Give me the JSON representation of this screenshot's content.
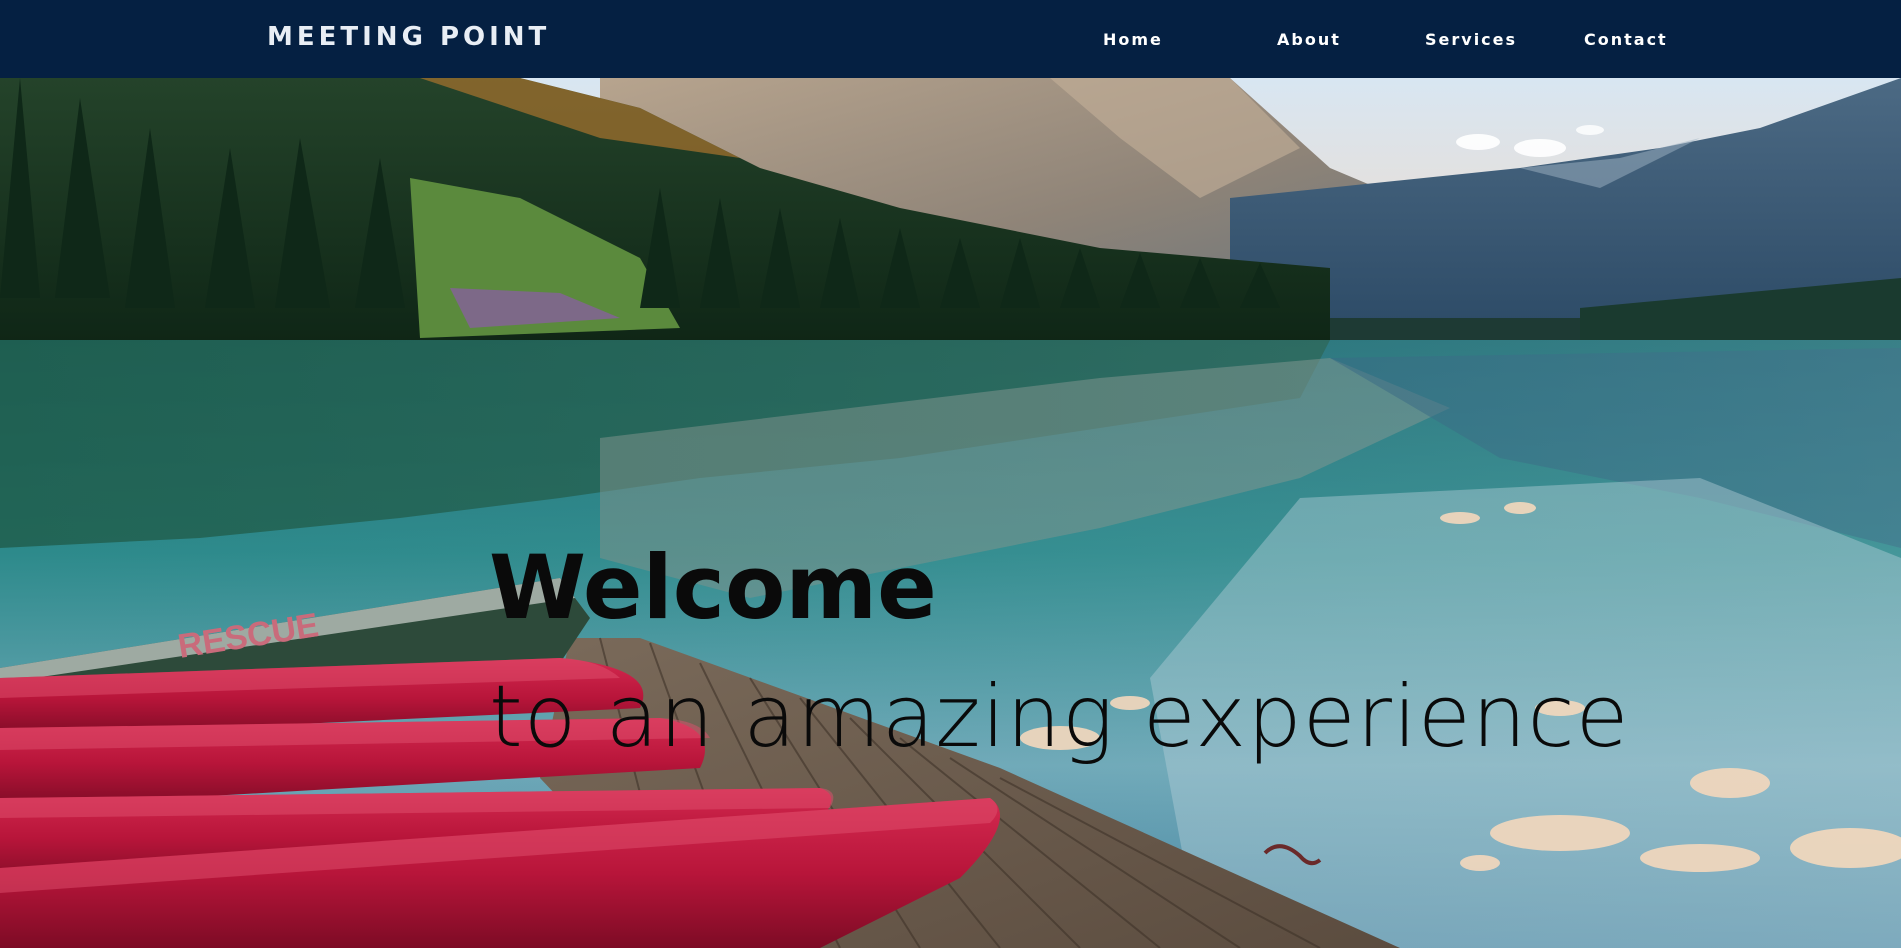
{
  "brand": {
    "name": "MEETING POINT"
  },
  "nav": {
    "items": [
      {
        "label": "Home"
      },
      {
        "label": "About"
      },
      {
        "label": "Services"
      },
      {
        "label": "Contact"
      }
    ]
  },
  "hero": {
    "heading": "Welcome",
    "subheading": "to an amazing experience",
    "background_description_icon": "lake-landscape-photo",
    "boat_text": "RESCUE"
  },
  "colors": {
    "navbar": "#052042",
    "kayak_red": "#b8153a",
    "water_teal": "#2e8a8c",
    "forest": "#1d3a24"
  }
}
